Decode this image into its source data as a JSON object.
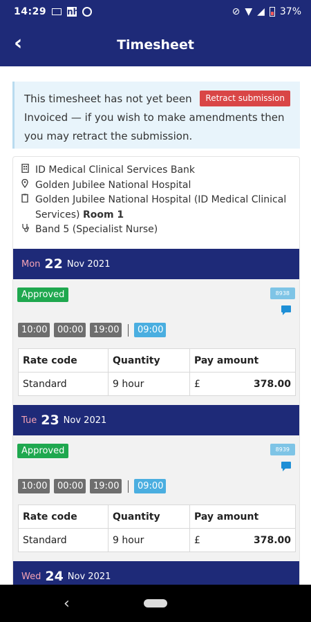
{
  "status": {
    "time": "14:29",
    "battery": "37%"
  },
  "header": {
    "title": "Timesheet",
    "back": "‹"
  },
  "notice": {
    "text": "This timesheet has not yet been Invoiced — if you wish to make amendments then you may retract the submission.",
    "retract_label": "Retract submission"
  },
  "info": {
    "bank": "ID Medical Clinical Services Bank",
    "hospital": "Golden Jubilee National Hospital",
    "ward_prefix": "Golden Jubilee National Hospital (ID Medical Clinical Services)",
    "ward_room": "Room 1",
    "band": "Band 5 (Specialist Nurse)"
  },
  "days": [
    {
      "dow": "Mon",
      "day": "22",
      "month_year": "Nov 2021",
      "status": "Approved",
      "ref": "8938",
      "times": [
        "10:00",
        "00:00",
        "19:00"
      ],
      "hours": "09:00",
      "headers": [
        "Rate code",
        "Quantity",
        "Pay amount"
      ],
      "rate_code": "Standard",
      "quantity": "9 hour",
      "currency": "£",
      "amount": "378.00"
    },
    {
      "dow": "Tue",
      "day": "23",
      "month_year": "Nov 2021",
      "status": "Approved",
      "ref": "8939",
      "times": [
        "10:00",
        "00:00",
        "19:00"
      ],
      "hours": "09:00",
      "headers": [
        "Rate code",
        "Quantity",
        "Pay amount"
      ],
      "rate_code": "Standard",
      "quantity": "9 hour",
      "currency": "£",
      "amount": "378.00"
    },
    {
      "dow": "Wed",
      "day": "24",
      "month_year": "Nov 2021"
    }
  ]
}
